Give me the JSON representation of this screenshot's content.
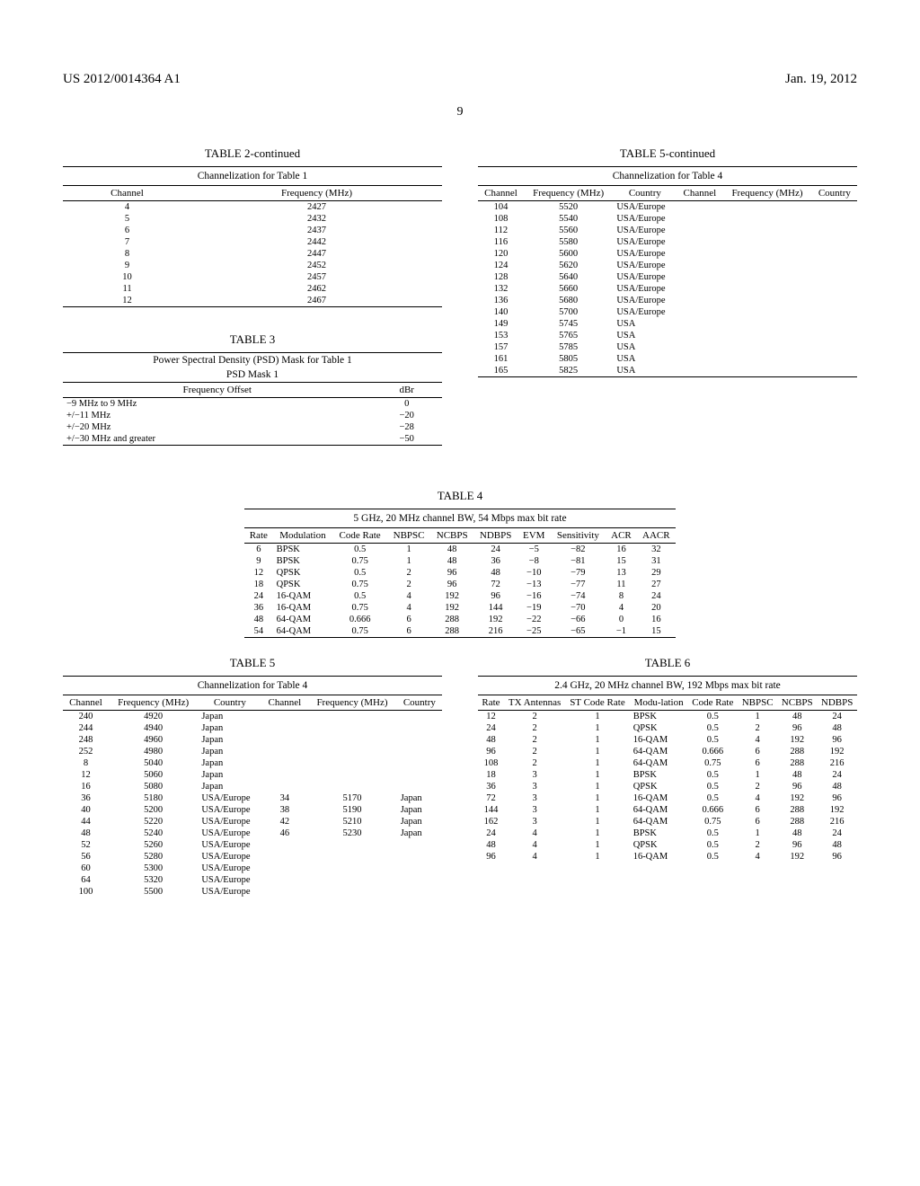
{
  "header": {
    "left": "US 2012/0014364 A1",
    "right": "Jan. 19, 2012"
  },
  "page_number": "9",
  "table2": {
    "title": "TABLE 2-continued",
    "subtitle": "Channelization for Table 1",
    "headers": [
      "Channel",
      "Frequency (MHz)"
    ],
    "rows": [
      [
        "4",
        "2427"
      ],
      [
        "5",
        "2432"
      ],
      [
        "6",
        "2437"
      ],
      [
        "7",
        "2442"
      ],
      [
        "8",
        "2447"
      ],
      [
        "9",
        "2452"
      ],
      [
        "10",
        "2457"
      ],
      [
        "11",
        "2462"
      ],
      [
        "12",
        "2467"
      ]
    ]
  },
  "table3": {
    "title": "TABLE 3",
    "subtitle1": "Power Spectral Density (PSD) Mask for Table 1",
    "subtitle2": "PSD Mask 1",
    "headers": [
      "Frequency Offset",
      "dBr"
    ],
    "rows": [
      [
        "−9 MHz to 9 MHz",
        "0"
      ],
      [
        "+/−11 MHz",
        "−20"
      ],
      [
        "+/−20 MHz",
        "−28"
      ],
      [
        "+/−30 MHz and greater",
        "−50"
      ]
    ]
  },
  "table4": {
    "title": "TABLE 4",
    "subtitle": "5 GHz, 20 MHz channel BW, 54 Mbps max bit rate",
    "headers": [
      "Rate",
      "Modulation",
      "Code Rate",
      "NBPSC",
      "NCBPS",
      "NDBPS",
      "EVM",
      "Sensitivity",
      "ACR",
      "AACR"
    ],
    "rows": [
      [
        "6",
        "BPSK",
        "0.5",
        "1",
        "48",
        "24",
        "−5",
        "−82",
        "16",
        "32"
      ],
      [
        "9",
        "BPSK",
        "0.75",
        "1",
        "48",
        "36",
        "−8",
        "−81",
        "15",
        "31"
      ],
      [
        "12",
        "QPSK",
        "0.5",
        "2",
        "96",
        "48",
        "−10",
        "−79",
        "13",
        "29"
      ],
      [
        "18",
        "QPSK",
        "0.75",
        "2",
        "96",
        "72",
        "−13",
        "−77",
        "11",
        "27"
      ],
      [
        "24",
        "16-QAM",
        "0.5",
        "4",
        "192",
        "96",
        "−16",
        "−74",
        "8",
        "24"
      ],
      [
        "36",
        "16-QAM",
        "0.75",
        "4",
        "192",
        "144",
        "−19",
        "−70",
        "4",
        "20"
      ],
      [
        "48",
        "64-QAM",
        "0.666",
        "6",
        "288",
        "192",
        "−22",
        "−66",
        "0",
        "16"
      ],
      [
        "54",
        "64-QAM",
        "0.75",
        "6",
        "288",
        "216",
        "−25",
        "−65",
        "−1",
        "15"
      ]
    ]
  },
  "table5": {
    "title": "TABLE 5",
    "subtitle": "Channelization for Table 4",
    "headers": [
      "Channel",
      "Frequency (MHz)",
      "Country",
      "Channel",
      "Frequency (MHz)",
      "Country"
    ],
    "rows": [
      [
        "240",
        "4920",
        "Japan",
        "",
        "",
        ""
      ],
      [
        "244",
        "4940",
        "Japan",
        "",
        "",
        ""
      ],
      [
        "248",
        "4960",
        "Japan",
        "",
        "",
        ""
      ],
      [
        "252",
        "4980",
        "Japan",
        "",
        "",
        ""
      ],
      [
        "8",
        "5040",
        "Japan",
        "",
        "",
        ""
      ],
      [
        "12",
        "5060",
        "Japan",
        "",
        "",
        ""
      ],
      [
        "16",
        "5080",
        "Japan",
        "",
        "",
        ""
      ],
      [
        "36",
        "5180",
        "USA/Europe",
        "34",
        "5170",
        "Japan"
      ],
      [
        "40",
        "5200",
        "USA/Europe",
        "38",
        "5190",
        "Japan"
      ],
      [
        "44",
        "5220",
        "USA/Europe",
        "42",
        "5210",
        "Japan"
      ],
      [
        "48",
        "5240",
        "USA/Europe",
        "46",
        "5230",
        "Japan"
      ],
      [
        "52",
        "5260",
        "USA/Europe",
        "",
        "",
        ""
      ],
      [
        "56",
        "5280",
        "USA/Europe",
        "",
        "",
        ""
      ],
      [
        "60",
        "5300",
        "USA/Europe",
        "",
        "",
        ""
      ],
      [
        "64",
        "5320",
        "USA/Europe",
        "",
        "",
        ""
      ],
      [
        "100",
        "5500",
        "USA/Europe",
        "",
        "",
        ""
      ]
    ]
  },
  "table5cont": {
    "title": "TABLE 5-continued",
    "subtitle": "Channelization for Table 4",
    "headers": [
      "Channel",
      "Frequency (MHz)",
      "Country",
      "Channel",
      "Frequency (MHz)",
      "Country"
    ],
    "rows": [
      [
        "104",
        "5520",
        "USA/Europe",
        "",
        "",
        ""
      ],
      [
        "108",
        "5540",
        "USA/Europe",
        "",
        "",
        ""
      ],
      [
        "112",
        "5560",
        "USA/Europe",
        "",
        "",
        ""
      ],
      [
        "116",
        "5580",
        "USA/Europe",
        "",
        "",
        ""
      ],
      [
        "120",
        "5600",
        "USA/Europe",
        "",
        "",
        ""
      ],
      [
        "124",
        "5620",
        "USA/Europe",
        "",
        "",
        ""
      ],
      [
        "128",
        "5640",
        "USA/Europe",
        "",
        "",
        ""
      ],
      [
        "132",
        "5660",
        "USA/Europe",
        "",
        "",
        ""
      ],
      [
        "136",
        "5680",
        "USA/Europe",
        "",
        "",
        ""
      ],
      [
        "140",
        "5700",
        "USA/Europe",
        "",
        "",
        ""
      ],
      [
        "149",
        "5745",
        "USA",
        "",
        "",
        ""
      ],
      [
        "153",
        "5765",
        "USA",
        "",
        "",
        ""
      ],
      [
        "157",
        "5785",
        "USA",
        "",
        "",
        ""
      ],
      [
        "161",
        "5805",
        "USA",
        "",
        "",
        ""
      ],
      [
        "165",
        "5825",
        "USA",
        "",
        "",
        ""
      ]
    ]
  },
  "table6": {
    "title": "TABLE 6",
    "subtitle": "2.4 GHz, 20 MHz channel BW, 192 Mbps max bit rate",
    "headers": [
      "Rate",
      "TX Antennas",
      "ST Code Rate",
      "Modu-lation",
      "Code Rate",
      "NBPSC",
      "NCBPS",
      "NDBPS"
    ],
    "rows": [
      [
        "12",
        "2",
        "1",
        "BPSK",
        "0.5",
        "1",
        "48",
        "24"
      ],
      [
        "24",
        "2",
        "1",
        "QPSK",
        "0.5",
        "2",
        "96",
        "48"
      ],
      [
        "48",
        "2",
        "1",
        "16-QAM",
        "0.5",
        "4",
        "192",
        "96"
      ],
      [
        "96",
        "2",
        "1",
        "64-QAM",
        "0.666",
        "6",
        "288",
        "192"
      ],
      [
        "108",
        "2",
        "1",
        "64-QAM",
        "0.75",
        "6",
        "288",
        "216"
      ],
      [
        "18",
        "3",
        "1",
        "BPSK",
        "0.5",
        "1",
        "48",
        "24"
      ],
      [
        "36",
        "3",
        "1",
        "QPSK",
        "0.5",
        "2",
        "96",
        "48"
      ],
      [
        "72",
        "3",
        "1",
        "16-QAM",
        "0.5",
        "4",
        "192",
        "96"
      ],
      [
        "144",
        "3",
        "1",
        "64-QAM",
        "0.666",
        "6",
        "288",
        "192"
      ],
      [
        "162",
        "3",
        "1",
        "64-QAM",
        "0.75",
        "6",
        "288",
        "216"
      ],
      [
        "24",
        "4",
        "1",
        "BPSK",
        "0.5",
        "1",
        "48",
        "24"
      ],
      [
        "48",
        "4",
        "1",
        "QPSK",
        "0.5",
        "2",
        "96",
        "48"
      ],
      [
        "96",
        "4",
        "1",
        "16-QAM",
        "0.5",
        "4",
        "192",
        "96"
      ]
    ]
  }
}
